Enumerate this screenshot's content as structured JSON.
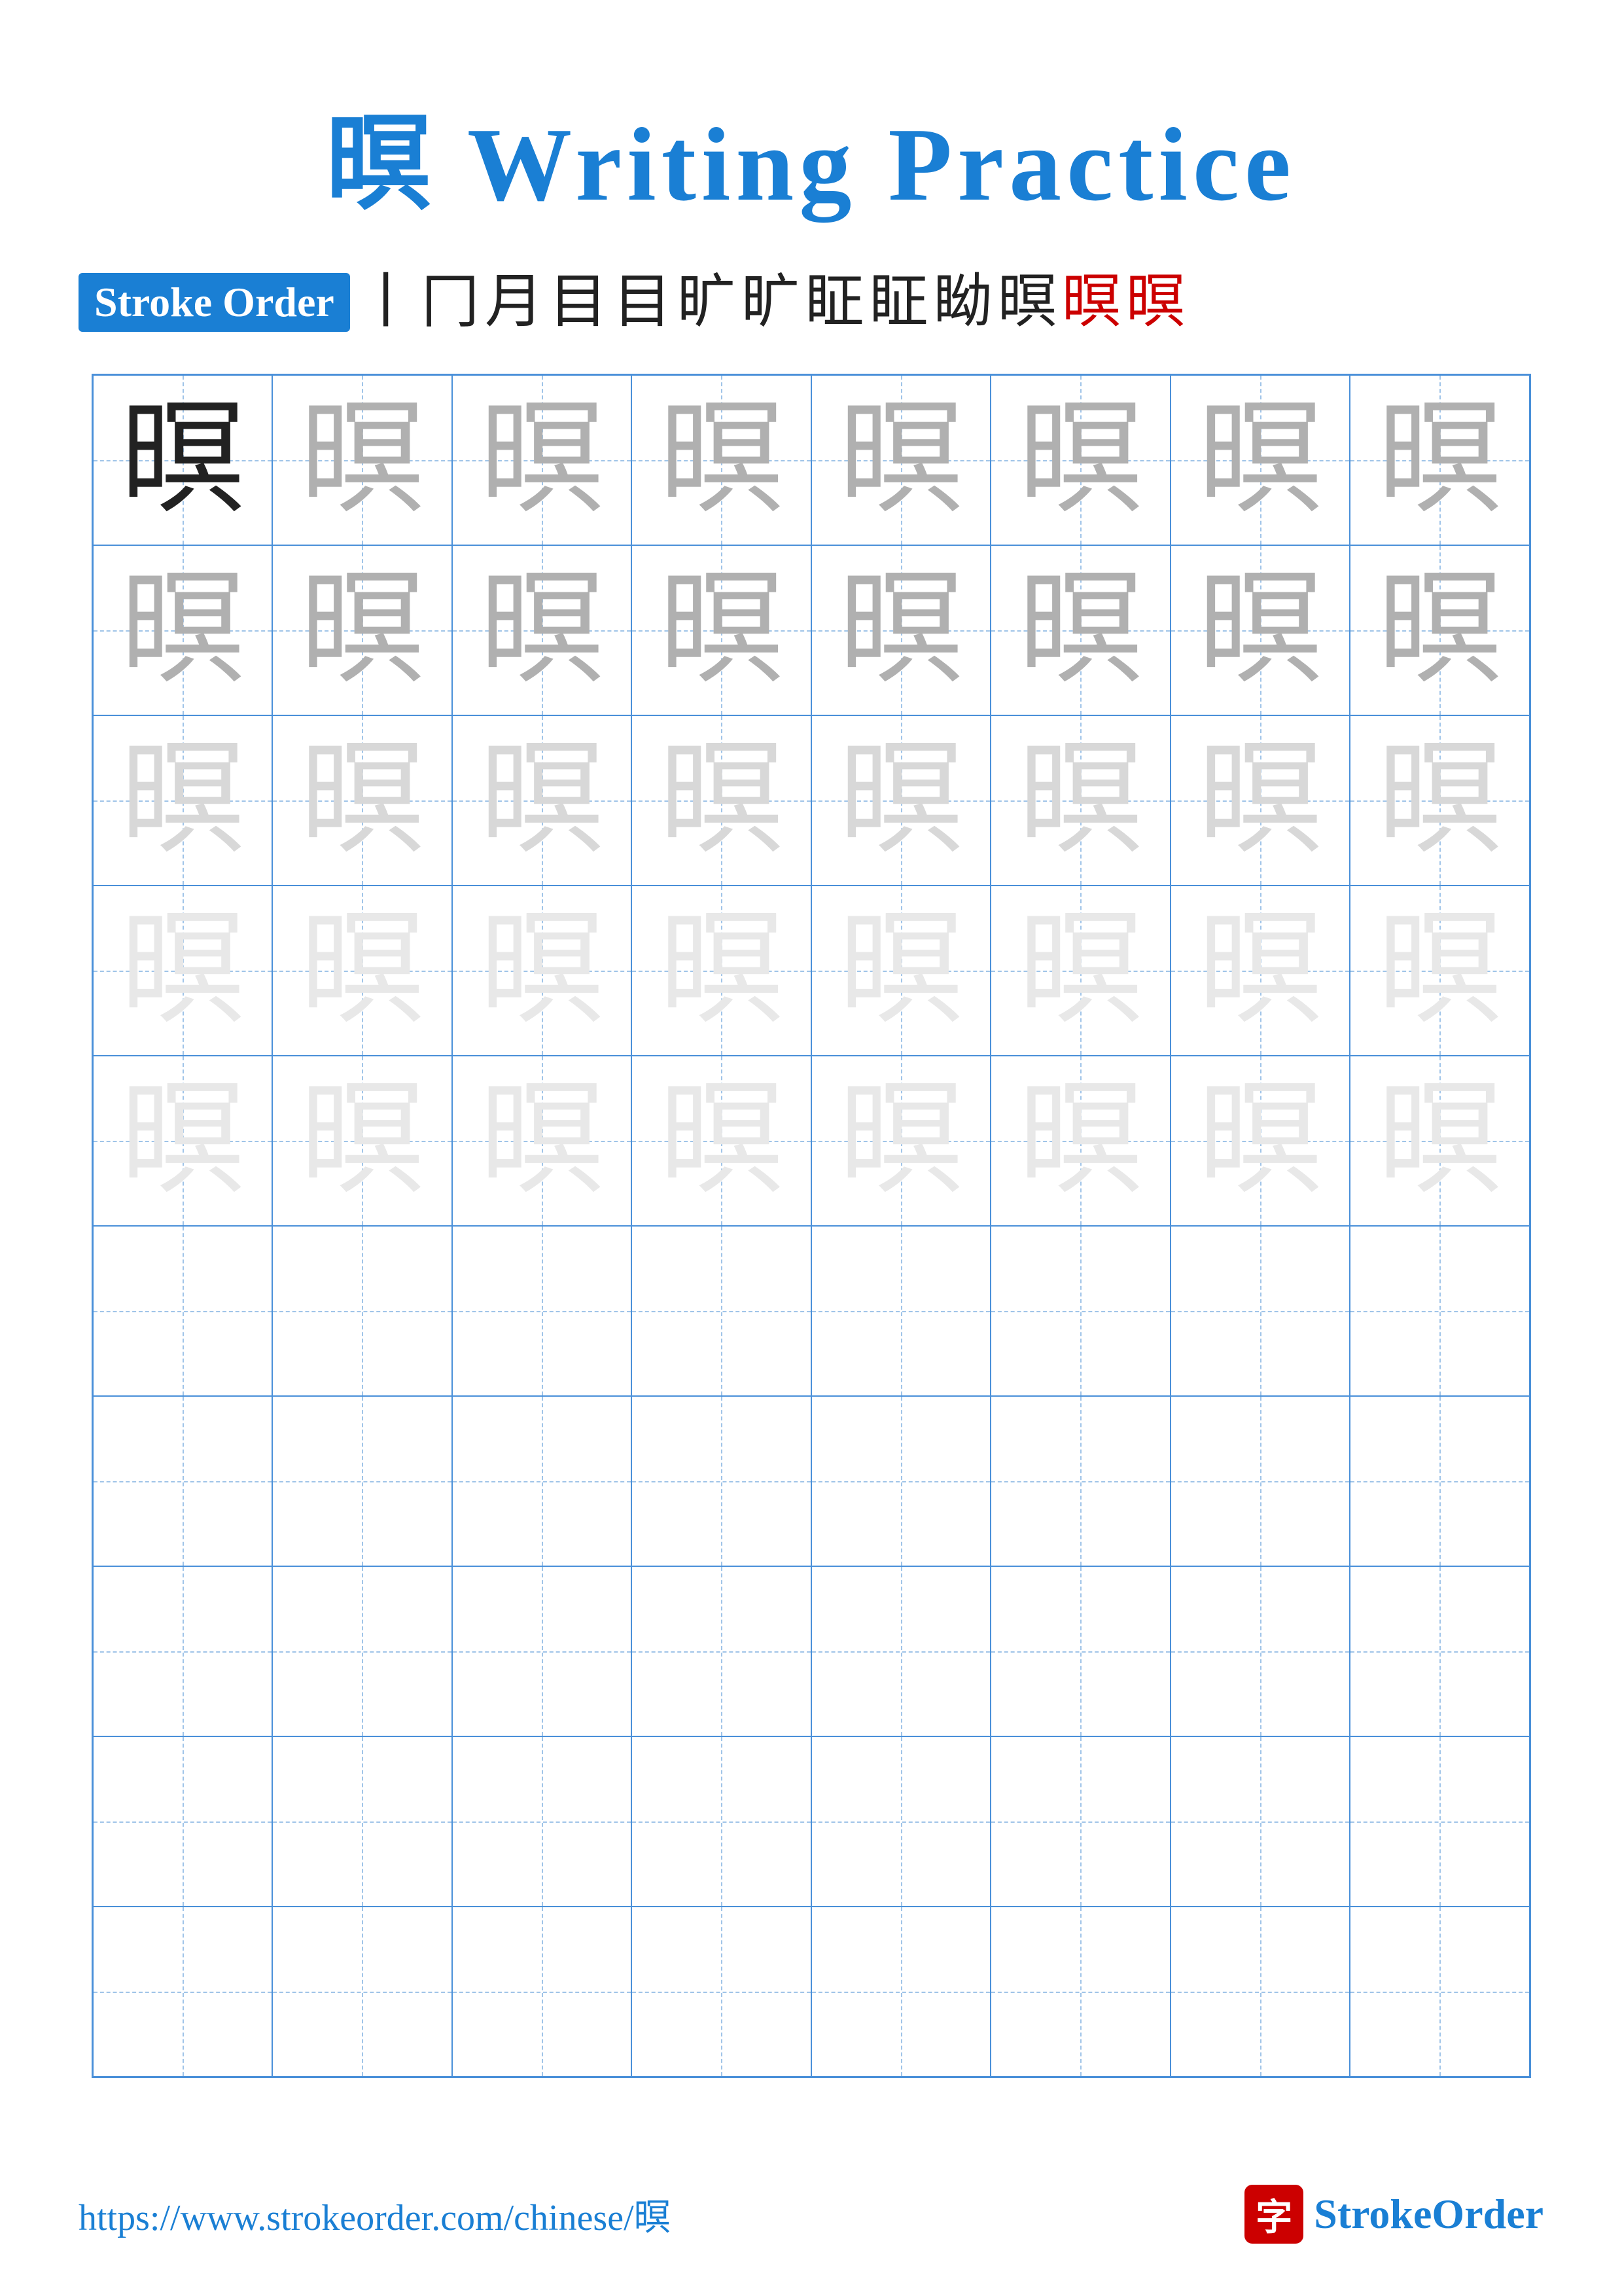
{
  "title": {
    "char": "暝",
    "suffix": " Writing Practice"
  },
  "stroke_order": {
    "label": "Stroke Order",
    "sequence": [
      "丨",
      "冂",
      "月",
      "目",
      "目'",
      "旷",
      "旷",
      "眐",
      "眐",
      "眑",
      "眒",
      "暝",
      "暝"
    ]
  },
  "grid": {
    "rows": 10,
    "cols": 8,
    "char": "暝",
    "shading_rows": [
      "dark",
      "medium",
      "light",
      "vlight",
      "vlight",
      "empty",
      "empty",
      "empty",
      "empty",
      "empty"
    ]
  },
  "footer": {
    "url": "https://www.strokeorder.com/chinese/暝",
    "brand_char": "字",
    "brand_name_part1": "Stroke",
    "brand_name_part2": "Order"
  }
}
